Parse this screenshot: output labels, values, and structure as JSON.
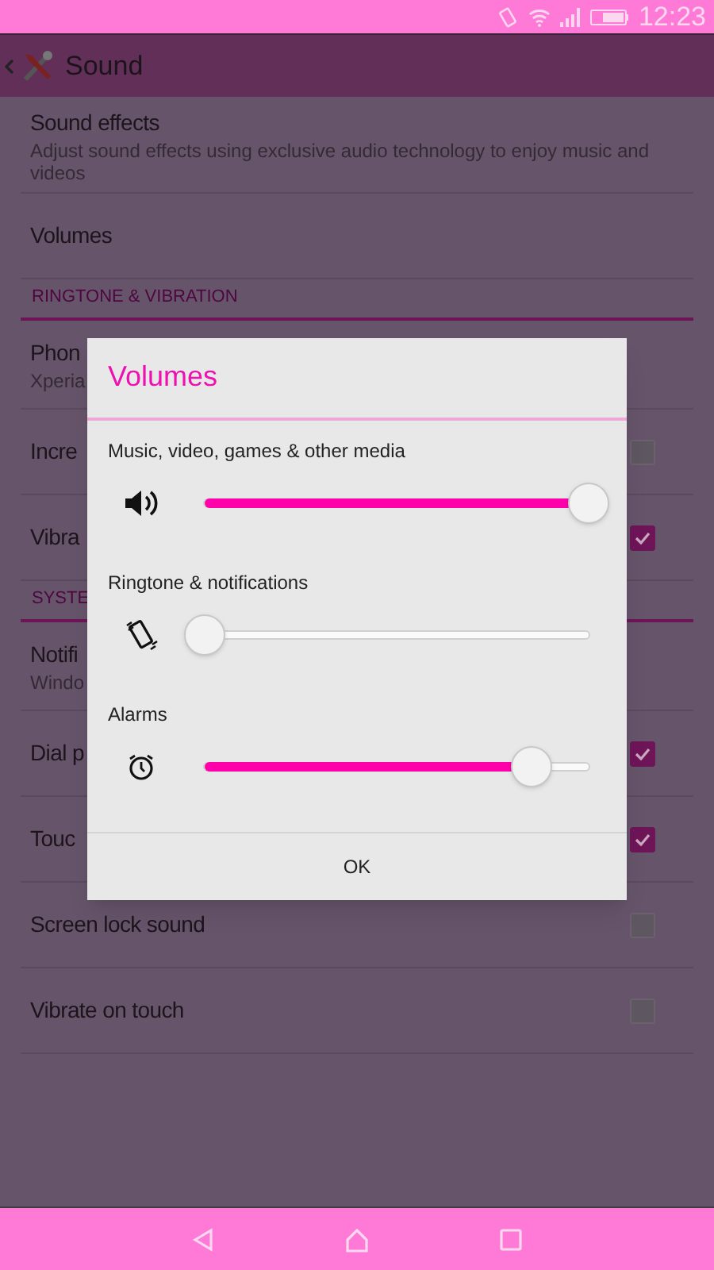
{
  "status_bar": {
    "time": "12:23"
  },
  "action_bar": {
    "title": "Sound"
  },
  "list": [
    {
      "kind": "item",
      "title": "Sound effects",
      "summary": "Adjust sound effects using exclusive audio technology to enjoy music and videos"
    },
    {
      "kind": "item",
      "title": "Volumes"
    },
    {
      "kind": "header",
      "title": "RINGTONE & VIBRATION"
    },
    {
      "kind": "item",
      "title": "Phon",
      "summary": "Xperia"
    },
    {
      "kind": "check",
      "title": "Incre",
      "checked": false
    },
    {
      "kind": "check",
      "title": "Vibra",
      "checked": true
    },
    {
      "kind": "header",
      "title": "SYSTE"
    },
    {
      "kind": "item",
      "title": "Notifi",
      "summary": "Windo"
    },
    {
      "kind": "check",
      "title": "Dial p",
      "checked": true
    },
    {
      "kind": "check",
      "title": "Touc",
      "checked": true
    },
    {
      "kind": "check",
      "title": "Screen lock sound",
      "checked": false
    },
    {
      "kind": "check",
      "title": "Vibrate on touch",
      "checked": false
    }
  ],
  "dialog": {
    "title": "Volumes",
    "channels": [
      {
        "name": "Music, video, games & other media",
        "kind": "media",
        "level": 1.0
      },
      {
        "name": "Ringtone & notifications",
        "kind": "vibrate",
        "level": 0.0
      },
      {
        "name": "Alarms",
        "kind": "alarm",
        "level": 0.85
      }
    ],
    "button": "OK"
  }
}
